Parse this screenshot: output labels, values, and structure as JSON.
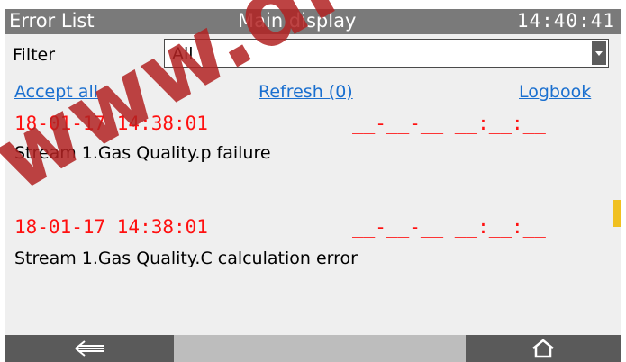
{
  "titlebar": {
    "left": "Error List",
    "center": "Main display",
    "time": "14:40:41"
  },
  "filter": {
    "label": "Filter",
    "value": "All"
  },
  "actions": {
    "accept_all": "Accept all",
    "refresh": "Refresh (0)",
    "logbook": "Logbook"
  },
  "entries": [
    {
      "timestamp": "18-01-17 14:38:01",
      "ack": "__-__-__ __:__:__",
      "message": "Stream 1.Gas Quality.p failure"
    },
    {
      "timestamp": "18-01-17 14:38:01",
      "ack": "__-__-__ __:__:__",
      "message": "Stream 1.Gas Quality.C calculation error"
    }
  ],
  "navigation": {
    "back_icon": "arrow-left-icon",
    "home_icon": "home-icon"
  },
  "watermark": {
    "text": "www.dr"
  },
  "colors": {
    "titlebar": "#7a7a7a",
    "link": "#1a6fcf",
    "error_red": "#ff1010",
    "nav_dark": "#5a5a5a",
    "watermark": "#b22222"
  }
}
